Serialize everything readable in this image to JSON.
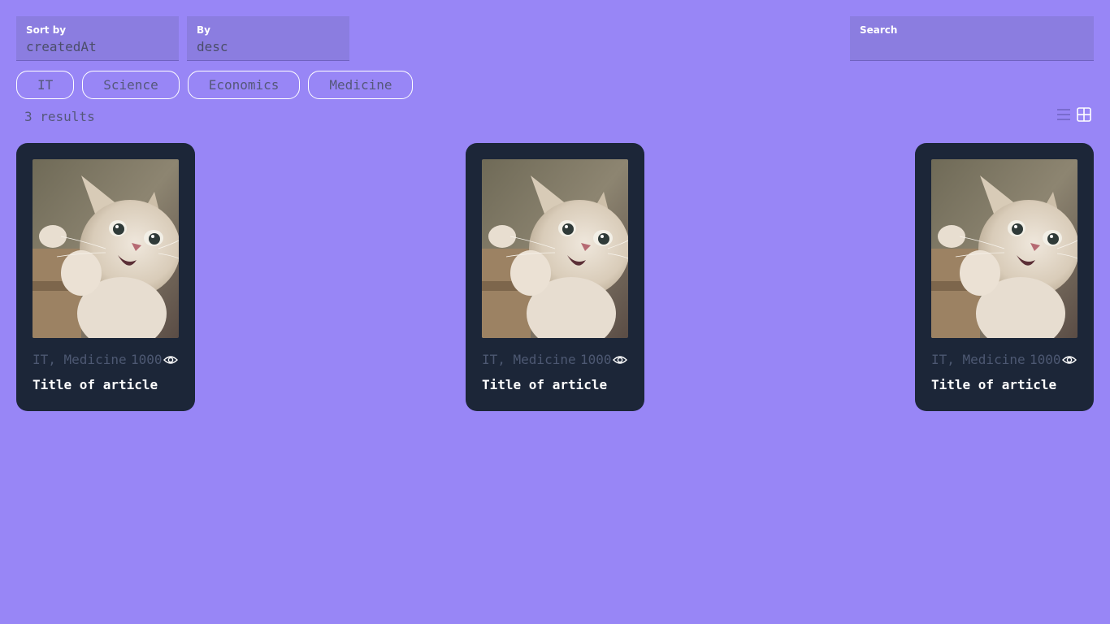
{
  "filters": {
    "sort_by": {
      "label": "Sort by",
      "value": "createdAt"
    },
    "order": {
      "label": "By",
      "value": "desc"
    },
    "search": {
      "label": "Search",
      "value": ""
    }
  },
  "tabs": [
    {
      "label": "IT"
    },
    {
      "label": "Science"
    },
    {
      "label": "Economics"
    },
    {
      "label": "Medicine"
    }
  ],
  "results_text": "3 results",
  "view_toggle": {
    "list_icon": "list-icon",
    "grid_icon": "grid-icon",
    "active": "grid"
  },
  "articles": [
    {
      "tags": "IT, Medicine",
      "views": "1000",
      "title": "Title of article",
      "image": "kitten-photo"
    },
    {
      "tags": "IT, Medicine",
      "views": "1000",
      "title": "Title of article",
      "image": "kitten-photo"
    },
    {
      "tags": "IT, Medicine",
      "views": "1000",
      "title": "Title of article",
      "image": "kitten-photo"
    }
  ],
  "colors": {
    "background": "#9886f6",
    "card": "#1c2638",
    "field": "#8b7de0",
    "muted_text": "#55587a",
    "card_meta": "#4d5872"
  }
}
